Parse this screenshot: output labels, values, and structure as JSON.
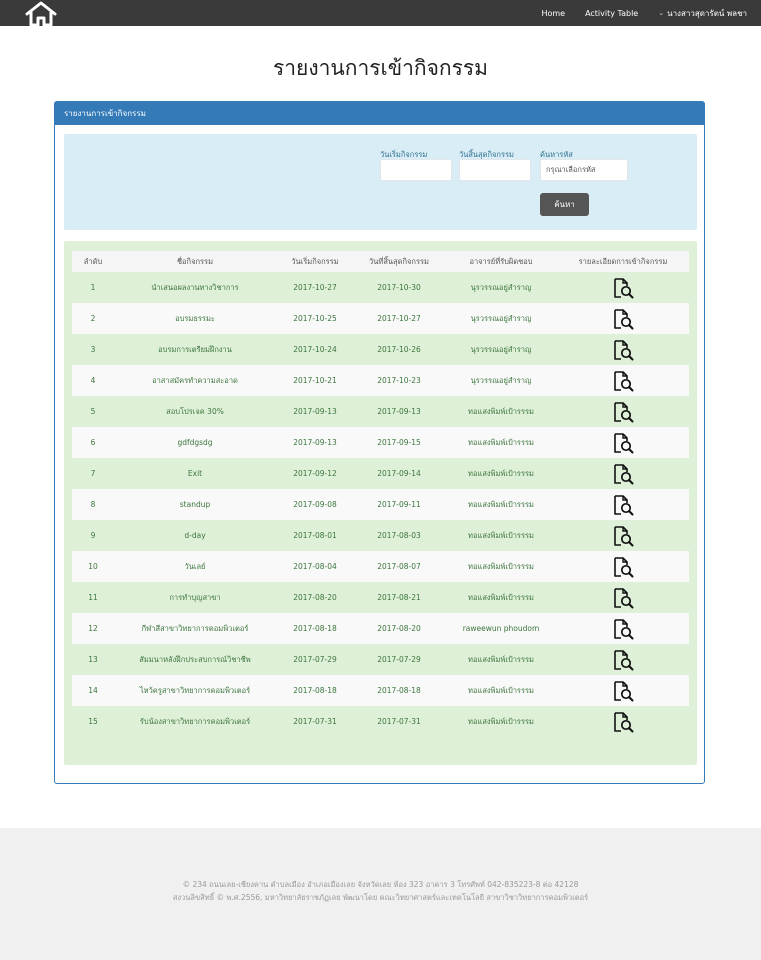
{
  "nav": {
    "home_label": "Home",
    "activity_label": "Activity Table",
    "user_name": "นางสาวสุดารัตน์ พลชา",
    "home_icon": "home-icon",
    "user_menu_icon": "chevron-down-icon"
  },
  "page_title": "รายงานการเข้ากิจกรรม",
  "panel": {
    "heading": "รายงานการเข้ากิจกรรม",
    "accent_color": "#337ab7"
  },
  "filter": {
    "start_label": "วันเริ่มกิจกรรม",
    "start_value": "",
    "end_label": "วันสิ้นสุดกิจกรรม",
    "end_value": "",
    "code_label": "ค้นหารหัส",
    "code_placeholder": "กรุณาเลือกรหัส",
    "search_button": "ค้นหา"
  },
  "table": {
    "columns": [
      "ลำดับ",
      "ชื่อกิจกรรม",
      "วันเริ่มกิจกรรม",
      "วันที่สิ้นสุดกิจกรรม",
      "อาจารย์ที่รับผิดชอบ",
      "รายละเอียดการเข้ากิจกรรม"
    ],
    "detail_icon": "document-search-icon",
    "rows": [
      {
        "no": "1",
        "name": "นำเสนอผลงานทางวิชาการ",
        "start": "2017-10-27",
        "end": "2017-10-30",
        "teacher": "นุรวรรณอยู่สำราญ"
      },
      {
        "no": "2",
        "name": "อบรมธรรมะ",
        "start": "2017-10-25",
        "end": "2017-10-27",
        "teacher": "นุรวรรณอยู่สำราญ"
      },
      {
        "no": "3",
        "name": "อบรมการเตรียมฝึกงาน",
        "start": "2017-10-24",
        "end": "2017-10-26",
        "teacher": "นุรวรรณอยู่สำราญ"
      },
      {
        "no": "4",
        "name": "อาสาสมัครทำความสะอาด",
        "start": "2017-10-21",
        "end": "2017-10-23",
        "teacher": "นุรวรรณอยู่สำราญ"
      },
      {
        "no": "5",
        "name": "สอบโปรเจค 30%",
        "start": "2017-09-13",
        "end": "2017-09-13",
        "teacher": "ทอแสงพิมพ์เป้ารรรม"
      },
      {
        "no": "6",
        "name": "gdfdgsdg",
        "start": "2017-09-13",
        "end": "2017-09-15",
        "teacher": "ทอแสงพิมพ์เป้ารรรม"
      },
      {
        "no": "7",
        "name": "Exit",
        "start": "2017-09-12",
        "end": "2017-09-14",
        "teacher": "ทอแสงพิมพ์เป้ารรรม"
      },
      {
        "no": "8",
        "name": "standup",
        "start": "2017-09-08",
        "end": "2017-09-11",
        "teacher": "ทอแสงพิมพ์เป้ารรรม"
      },
      {
        "no": "9",
        "name": "d-day",
        "start": "2017-08-01",
        "end": "2017-08-03",
        "teacher": "ทอแสงพิมพ์เป้ารรรม"
      },
      {
        "no": "10",
        "name": "วันเลย์",
        "start": "2017-08-04",
        "end": "2017-08-07",
        "teacher": "ทอแสงพิมพ์เป้ารรรม"
      },
      {
        "no": "11",
        "name": "การทำบุญสาขา",
        "start": "2017-08-20",
        "end": "2017-08-21",
        "teacher": "ทอแสงพิมพ์เป้ารรรม"
      },
      {
        "no": "12",
        "name": "กีฬาสีสาขาวิทยาการคอมพิวเตอร์",
        "start": "2017-08-18",
        "end": "2017-08-20",
        "teacher": "raweewun phoudom"
      },
      {
        "no": "13",
        "name": "สัมมนาหลังฝึกประสบการณ์วิชาชีพ",
        "start": "2017-07-29",
        "end": "2017-07-29",
        "teacher": "ทอแสงพิมพ์เป้ารรรม"
      },
      {
        "no": "14",
        "name": "ไหว้ครูสาขาวิทยาการคอมพิวเตอร์",
        "start": "2017-08-18",
        "end": "2017-08-18",
        "teacher": "ทอแสงพิมพ์เป้ารรรม"
      },
      {
        "no": "15",
        "name": "รับน้องสาขาวิทยาการคอมพิวเตอร์",
        "start": "2017-07-31",
        "end": "2017-07-31",
        "teacher": "ทอแสงพิมพ์เป้ารรรม"
      }
    ]
  },
  "footer": {
    "line1": "© 234 ถนนเลย-เชียงคาน ตำบลเมือง อำเภอเมืองเลย จังหวัดเลย ห้อง 323 อาคาร 3 โทรศัพท์ 042-835223-8 ต่อ 42128",
    "line2": "สงวนลิขสิทธิ์ © พ.ศ.2556, มหาวิทยาลัยราชภัฏเลย พัฒนาโดย คณะวิทยาศาสตร์และเทคโนโลยี สาขาวิชาวิทยาการคอมพิวเตอร์"
  }
}
